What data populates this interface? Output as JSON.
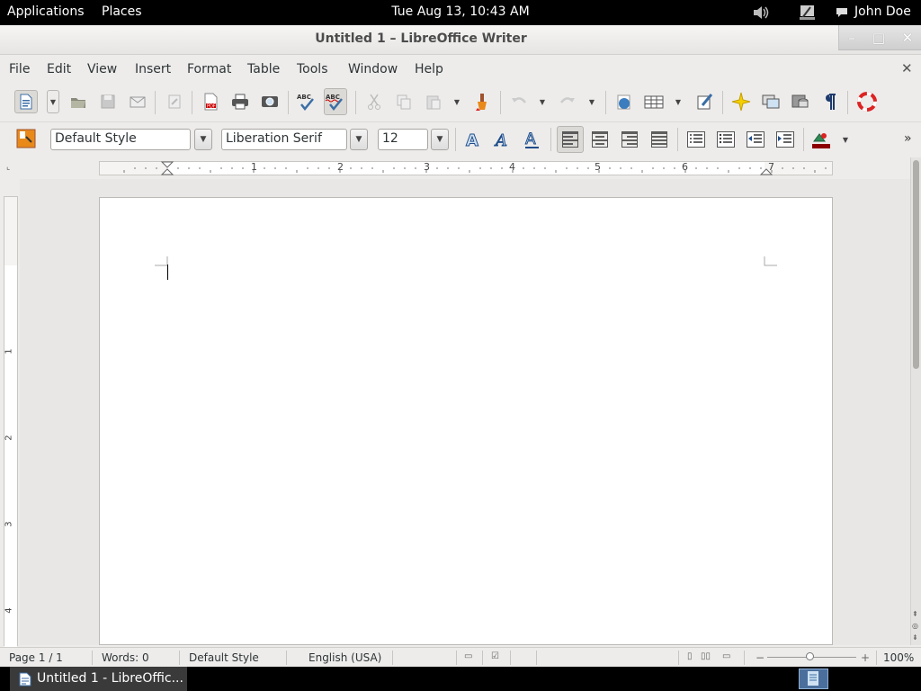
{
  "top_panel": {
    "applications": "Applications",
    "places": "Places",
    "clock": "Tue Aug 13, 10:43 AM",
    "user": "John Doe"
  },
  "window": {
    "title": "Untitled 1 – LibreOffice Writer",
    "minimize": "–",
    "maximize": "□",
    "close": "✕"
  },
  "menu": {
    "items": [
      "File",
      "Edit",
      "View",
      "Insert",
      "Format",
      "Table",
      "Tools",
      "Window",
      "Help"
    ],
    "close_doc": "✕"
  },
  "format_toolbar": {
    "paragraph_style": "Default Style",
    "font_name": "Liberation Serif",
    "font_size": "12",
    "more": "»"
  },
  "ruler": {
    "h_labels": [
      "1",
      "2",
      "3",
      "4",
      "5",
      "6",
      "7"
    ],
    "v_labels": [
      "1",
      "2",
      "3",
      "4"
    ]
  },
  "statusbar": {
    "page": "Page 1 / 1",
    "words": "Words: 0",
    "style": "Default Style",
    "language": "English (USA)",
    "zoom": "100%"
  },
  "taskbar": {
    "task_label": "Untitled 1 - LibreOffic..."
  },
  "colors": {
    "panel_bg": "#000000",
    "window_bg": "#edeceb",
    "page_bg": "#ffffff",
    "accent": "#3b7dbf"
  }
}
